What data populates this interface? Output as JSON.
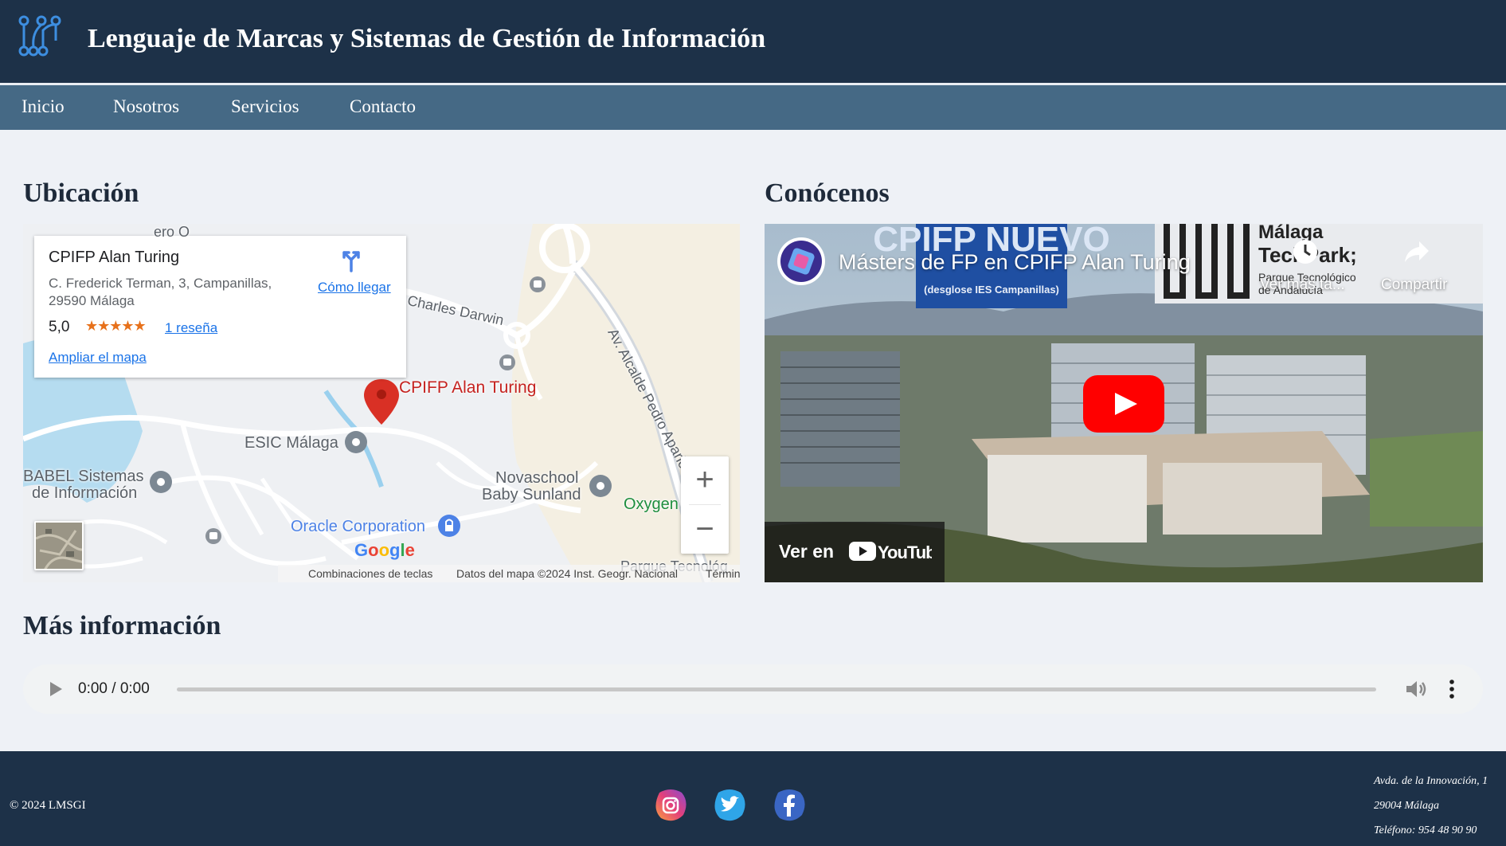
{
  "header": {
    "title": "Lenguaje de Marcas y Sistemas de Gestión de Información",
    "logo_icon": "molecule-logo-icon"
  },
  "nav": {
    "items": [
      {
        "label": "Inicio"
      },
      {
        "label": "Nosotros"
      },
      {
        "label": "Servicios"
      },
      {
        "label": "Contacto"
      }
    ]
  },
  "sections": {
    "location_title": "Ubicación",
    "video_title": "Conócenos",
    "more_info_title": "Más información"
  },
  "map": {
    "place_name": "CPIFP Alan Turing",
    "address_line1": "C. Frederick Terman, 3, Campanillas,",
    "address_line2": "29590 Málaga",
    "rating": "5,0",
    "stars": "★★★★★",
    "reviews_link": "1 reseña",
    "enlarge_link": "Ampliar el mapa",
    "directions_label": "Cómo llegar",
    "marker_label": "CPIFP Alan Turing",
    "labels": {
      "charles_darwin": "Charles Darwin",
      "alcalde": "Av. Alcalde Pedro Aparicio",
      "esic": "ESIC Málaga",
      "babel1": "BABEL Sistemas",
      "babel2": "de Información",
      "novaschool1": "Novaschool",
      "novaschool2": "Baby Sunland",
      "oracle": "Oracle Corporation",
      "oxygen": "Oxygen",
      "partial_top": "ero O",
      "parque": "Parque Tecnológ"
    },
    "zoom_in": "+",
    "zoom_out": "−",
    "footer": {
      "shortcuts": "Combinaciones de teclas",
      "data": "Datos del mapa ©2024 Inst. Geogr. Nacional",
      "terms": "Términos"
    },
    "google": [
      "G",
      "o",
      "o",
      "g",
      "l",
      "e"
    ],
    "colors": {
      "accent_link": "#1a73e8",
      "marker": "#d93025",
      "stars": "#e7711b"
    }
  },
  "video": {
    "title": "Másters de FP en CPIFP Alan Turing",
    "watch_later": "Ver más ta...",
    "share": "Compartir",
    "watch_on": "Ver en",
    "youtube_wordmark": "YouTube",
    "banner_text": "CPIFP NUEVO",
    "banner_sub": "(desglose IES Campanillas)",
    "park_text1": "Málaga",
    "park_text2": "TechPark;",
    "park_text3": "Parque Tecnológico",
    "park_text4": "de Andalucía",
    "colors": {
      "play_red": "#ff0000"
    }
  },
  "audio": {
    "time": "0:00 / 0:00",
    "progress": 0
  },
  "footer": {
    "copyright": "© 2024 LMSGI",
    "social": [
      {
        "icon": "instagram-icon"
      },
      {
        "icon": "twitter-icon"
      },
      {
        "icon": "facebook-icon"
      }
    ],
    "address1": "Avda. de la Innovación, 1",
    "address2": "29004 Málaga",
    "phone": "Teléfono: 954 48 90 90"
  }
}
